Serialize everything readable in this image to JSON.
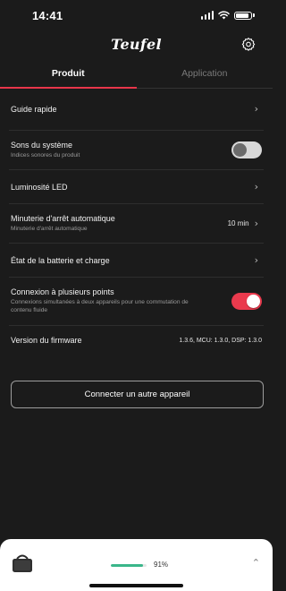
{
  "status_bar": {
    "time": "14:41"
  },
  "header": {
    "brand": "Teufel",
    "settings_icon": "gear-icon"
  },
  "tabs": [
    {
      "label": "Produit",
      "active": true
    },
    {
      "label": "Application",
      "active": false
    }
  ],
  "settings": {
    "guide": {
      "title": "Guide rapide",
      "icon": "chevron-right-icon"
    },
    "system_sounds": {
      "title": "Sons du système",
      "subtitle": "Indices sonores du produit",
      "enabled": false
    },
    "led": {
      "title": "Luminosité LED",
      "icon": "chevron-right-icon"
    },
    "auto_off": {
      "title": "Minuterie d'arrêt automatique",
      "subtitle": "Minuterie d'arrêt automatique",
      "value": "10 min"
    },
    "battery": {
      "title": "État de la batterie et charge",
      "icon": "chevron-right-icon"
    },
    "multipoint": {
      "title": "Connexion à plusieurs points",
      "subtitle": "Connexions simultanées à deux appareils pour une commutation de contenu fluide",
      "enabled": true
    },
    "firmware": {
      "title": "Version du firmware",
      "value": "1.3.6, MCU: 1.3.0, DSP: 1.3.0"
    }
  },
  "connect_button": {
    "label": "Connecter un autre appareil"
  },
  "bottom_bar": {
    "battery_percent_text": "91%",
    "battery_level": 0.91,
    "chevron_icon": "chevron-up-icon"
  },
  "colors": {
    "background": "#1b1b1b",
    "accent": "#e8364a",
    "battery": "#3ab68a"
  }
}
